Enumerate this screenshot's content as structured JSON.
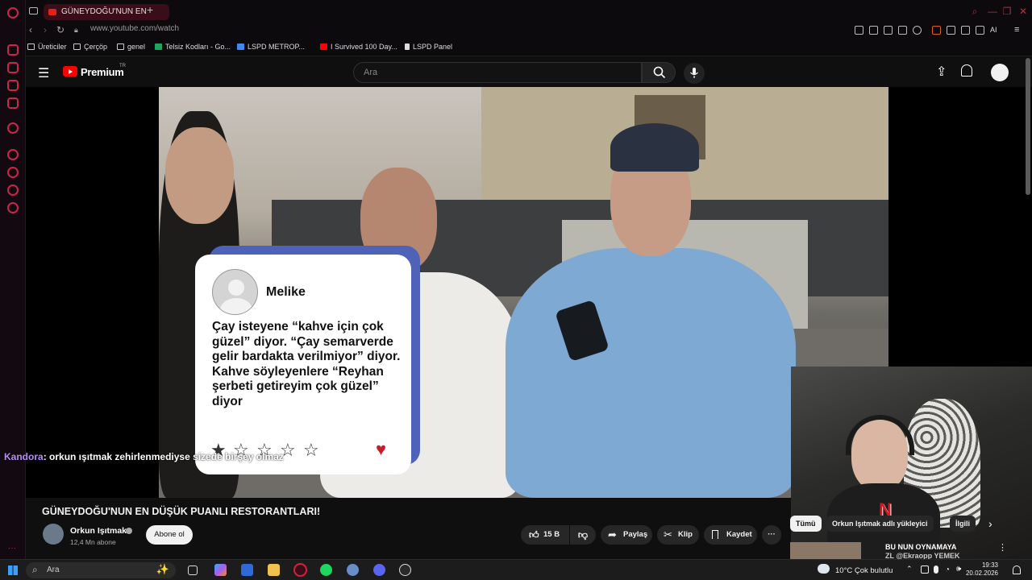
{
  "browser": {
    "tab_title": "GÜNEYDOĞU'NUN EN",
    "url": "www.youtube.com/watch",
    "bookmarks": [
      "Üreticiler",
      "Çerçöp",
      "genel",
      "Telsiz Kodları - Go...",
      "LSPD METROP...",
      "I Survived 100 Day...",
      "LSPD Panel"
    ],
    "right_label": "AI"
  },
  "youtube": {
    "logo_text": "Premium",
    "logo_superscript": "TR",
    "search_placeholder": "Ara"
  },
  "overlay_card": {
    "name": "Melike",
    "text": "Çay isteyene “kahve için çok güzel” diyor. “Çay semarverde gelir bardakta verilmiyor” diyor. Kahve söyleyenlere “Reyhan şerbeti getireyim çok güzel” diyor",
    "rating": 1,
    "max_rating": 5
  },
  "chat_overlay": {
    "user": "Kandora",
    "message": ": orkun ışıtmak zehirlenmediyse sizede birşey olmaz"
  },
  "video": {
    "title": "GÜNEYDOĞU'NUN EN DÜŞÜK PUANLI RESTORANTLARI!",
    "channel": "Orkun Işıtmak",
    "subscribers": "12,4 Mn abone",
    "subscribe_label": "Abone ol",
    "likes": "15 B",
    "share_label": "Paylaş",
    "clip_label": "Klip",
    "save_label": "Kaydet"
  },
  "related": {
    "chips": [
      "Tümü",
      "Orkun Işıtmak adlı yükleyici",
      "İlgili"
    ],
    "first_title": "BU NUN OYNAMAYA",
    "first_sub": "ZL @Ekraopp YEMEK"
  },
  "taskbar": {
    "search": "Ara",
    "weather": "10°C  Çok bulutlu",
    "time": "19:33",
    "date": "20.02.2026"
  },
  "colors": {
    "youtube_red": "#ff0000",
    "opera_accent": "#c8274a",
    "card_border": "#4e63b8",
    "heart": "#c81e2a"
  }
}
